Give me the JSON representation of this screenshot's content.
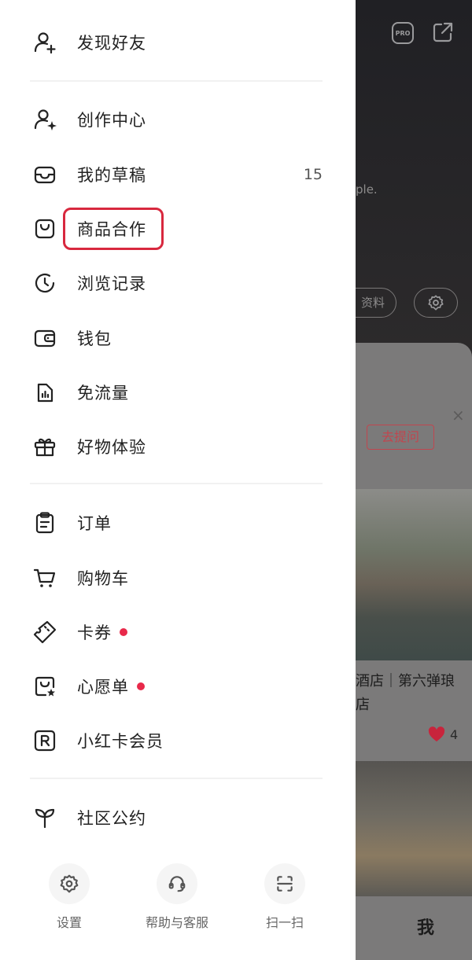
{
  "drawer": {
    "group1": [
      {
        "label": "发现好友",
        "icon": "add-friend-icon"
      }
    ],
    "group2": [
      {
        "label": "创作中心",
        "icon": "creator-icon"
      },
      {
        "label": "我的草稿",
        "icon": "inbox-icon",
        "count": "15"
      },
      {
        "label": "商品合作",
        "icon": "shopping-bag-icon",
        "highlighted": true
      },
      {
        "label": "浏览记录",
        "icon": "history-icon"
      },
      {
        "label": "钱包",
        "icon": "wallet-icon"
      },
      {
        "label": "免流量",
        "icon": "data-saver-icon"
      },
      {
        "label": "好物体验",
        "icon": "gift-icon"
      }
    ],
    "group3": [
      {
        "label": "订单",
        "icon": "order-icon"
      },
      {
        "label": "购物车",
        "icon": "cart-icon"
      },
      {
        "label": "卡券",
        "icon": "coupon-icon",
        "badge": true
      },
      {
        "label": "心愿单",
        "icon": "wishlist-icon",
        "badge": true
      },
      {
        "label": "小红卡会员",
        "icon": "membership-card-icon"
      }
    ],
    "group4": [
      {
        "label": "社区公约",
        "icon": "sprout-icon"
      }
    ],
    "bottom_actions": [
      {
        "label": "设置",
        "icon": "settings-icon"
      },
      {
        "label": "帮助与客服",
        "icon": "headset-icon"
      },
      {
        "label": "扫一扫",
        "icon": "scan-icon"
      }
    ],
    "highlight_color": "#d8283e",
    "badge_color": "#e8294a"
  },
  "background": {
    "pro_badge": "PRO",
    "bio_fragment": "ple.",
    "edit_profile_fragment": "资料",
    "ask_button": "去提问",
    "close_symbol": "×",
    "post_title_fragment": "酒店｜第六弹琅\n店",
    "like_count": "4",
    "bottom_tab_me": "我"
  }
}
